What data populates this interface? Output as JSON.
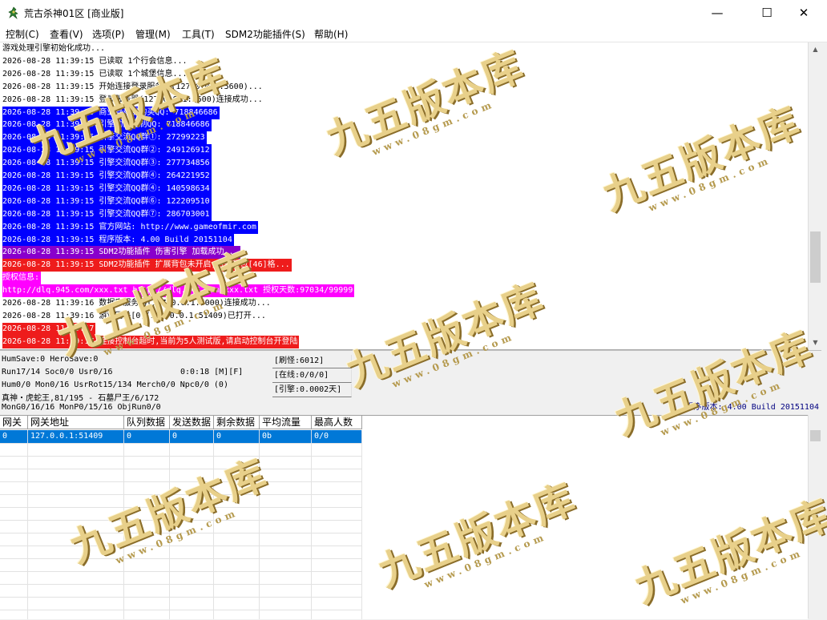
{
  "window": {
    "title": "荒古杀神01区 [商业版]",
    "minimize": "—",
    "maximize": "☐",
    "close": "✕"
  },
  "menu": [
    "控制(C)",
    "查看(V)",
    "选项(P)",
    "管理(M)",
    "工具(T)",
    "SDM2功能插件(S)",
    "帮助(H)"
  ],
  "log": [
    {
      "text": "游戏处理引擎初始化成功...",
      "bg": "",
      "fg": "#000000"
    },
    {
      "text": "2026-08-28 11:39:15 已读取 1个行会信息...",
      "bg": "",
      "fg": "#000000"
    },
    {
      "text": "2026-08-28 11:39:15 已读取 1个城堡信息...",
      "bg": "",
      "fg": "#000000"
    },
    {
      "text": "2026-08-28 11:39:15 开始连接登录服务器(127.0.0.1:5600)...",
      "bg": "",
      "fg": "#000000"
    },
    {
      "text": "2026-08-28 11:39:15 登录服务器(127.0.0.1:5600)连接成功...",
      "bg": "",
      "fg": "#000000"
    },
    {
      "text": "2026-08-28 11:39:15 商业登录器购买QQ: 718846686",
      "bg": "#0000ff",
      "fg": "#ffffff"
    },
    {
      "text": "2026-08-28 11:39:15 引擎功能定制QQ: 718846686",
      "bg": "#0000ff",
      "fg": "#ffffff"
    },
    {
      "text": "2026-08-28 11:39:15 引擎交流QQ群①: 27299223",
      "bg": "#0000ff",
      "fg": "#ffffff"
    },
    {
      "text": "2026-08-28 11:39:15 引擎交流QQ群②: 249126912",
      "bg": "#0000ff",
      "fg": "#ffffff"
    },
    {
      "text": "2026-08-28 11:39:15 引擎交流QQ群③: 277734856",
      "bg": "#0000ff",
      "fg": "#ffffff"
    },
    {
      "text": "2026-08-28 11:39:15 引擎交流QQ群④: 264221952",
      "bg": "#0000ff",
      "fg": "#ffffff"
    },
    {
      "text": "2026-08-28 11:39:15 引擎交流QQ群④: 140598634",
      "bg": "#0000ff",
      "fg": "#ffffff"
    },
    {
      "text": "2026-08-28 11:39:15 引擎交流QQ群⑥: 122209510",
      "bg": "#0000ff",
      "fg": "#ffffff"
    },
    {
      "text": "2026-08-28 11:39:15 引擎交流QQ群⑦: 286703001",
      "bg": "#0000ff",
      "fg": "#ffffff"
    },
    {
      "text": "2026-08-28 11:39:15 官方网站: http://www.gameofmir.com",
      "bg": "#0000ff",
      "fg": "#ffffff"
    },
    {
      "text": "2026-08-28 11:39:15 程序版本: 4.00 Build 20151104",
      "bg": "#0000ff",
      "fg": "#ffffff"
    },
    {
      "text": "2026-08-28 11:39:15 SDM2功能插件 伤害引擎 加载成功...",
      "bg": "#8800cc",
      "fg": "#ffffff"
    },
    {
      "text": "2026-08-28 11:39:15 SDM2功能插件 扩展背包未开启,当前背包[46]格...",
      "bg": "#ee1c1c",
      "fg": "#ffffff"
    },
    {
      "text": "授权信息:",
      "bg": "#ff00ff",
      "fg": "#ffffff"
    },
    {
      "text": "http://dlq.945.com/xxx.txt http://dlq.945.com/xxx.txt 授权天数:97034/99999",
      "bg": "#ff00ff",
      "fg": "#ffffff"
    },
    {
      "text": "2026-08-28 11:39:16 数据库服务器(127.0.0.1:6000)连接成功...",
      "bg": "",
      "fg": "#000000"
    },
    {
      "text": "2026-08-28 11:39:16 游戏网关[0](127.0.0.1:51409)已打开...",
      "bg": "",
      "fg": "#000000"
    },
    {
      "text": "2026-08-28 11:39:17",
      "bg": "#ee1c1c",
      "fg": "#ffffff"
    },
    {
      "text": "2026-08-28 11:39:17 连接控制台超时,当前为5人测试版,请启动控制台开登陆",
      "bg": "#ee1c1c",
      "fg": "#ffffff"
    }
  ],
  "status": {
    "line1": "HumSave:0 HeroSave:0",
    "line2": "Run17/14 Soc0/0 Usr0/16",
    "timer": "0:0:18 [M][F]",
    "line3": "Hum0/0 Mon0/16 UsrRot15/134 Merch0/0 Npc0/0 (0)",
    "line4": "真神・虎蛇王,81/195 - 石墓尸王/6/172",
    "line5": "MonG0/16/16 MonP0/15/16 ObjRun0/0",
    "refresh": "[刷怪:6012]",
    "online": "[在线:0/0/0]",
    "engine": "[引擎:0.0002天]",
    "version": "程序版本: 4.00 Build 20151104"
  },
  "grid": {
    "headers": [
      "网关",
      "网关地址",
      "队列数据",
      "发送数据",
      "剩余数据",
      "平均流量",
      "最高人数"
    ],
    "rows": [
      [
        "0",
        "127.0.0.1:51409",
        "0",
        "0",
        "0",
        "0b",
        "0/0"
      ]
    ]
  },
  "watermark": {
    "text": "九五版本库",
    "url": "www.08gm.com"
  },
  "colors": {
    "selection": "#0078d7",
    "version_text": "#000080"
  }
}
